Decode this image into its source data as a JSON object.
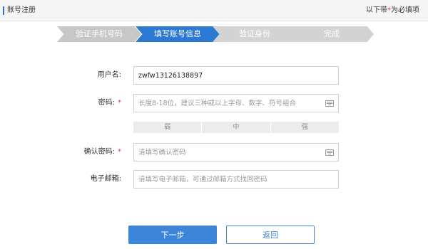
{
  "header": {
    "title": "账号注册",
    "required_note_prefix": "以下带",
    "required_note_star": "*",
    "required_note_suffix": "为必填项"
  },
  "steps": [
    {
      "label": "验证手机号码",
      "state": "done"
    },
    {
      "label": "填写账号信息",
      "state": "active"
    },
    {
      "label": "验证身份",
      "state": "todo"
    },
    {
      "label": "完成",
      "state": "todo"
    }
  ],
  "form": {
    "username": {
      "label": "用户名:",
      "value": "zwfw13126138897"
    },
    "password": {
      "label": "密码:",
      "required": "*",
      "placeholder": "长度8-18位，建议三种或以上字母、数字、符号组合"
    },
    "strength": {
      "weak": "弱",
      "medium": "中",
      "strong": "强"
    },
    "confirm_password": {
      "label": "确认密码:",
      "required": "*",
      "placeholder": "请填写确认密码"
    },
    "email": {
      "label": "电子邮箱:",
      "placeholder": "请填写电子邮箱，可通过邮箱方式找回密码"
    }
  },
  "buttons": {
    "next": "下一步",
    "back": "返回"
  },
  "colors": {
    "primary": "#2c79d3",
    "required": "#e23c3c",
    "step_inactive": "#d3d3d3"
  }
}
